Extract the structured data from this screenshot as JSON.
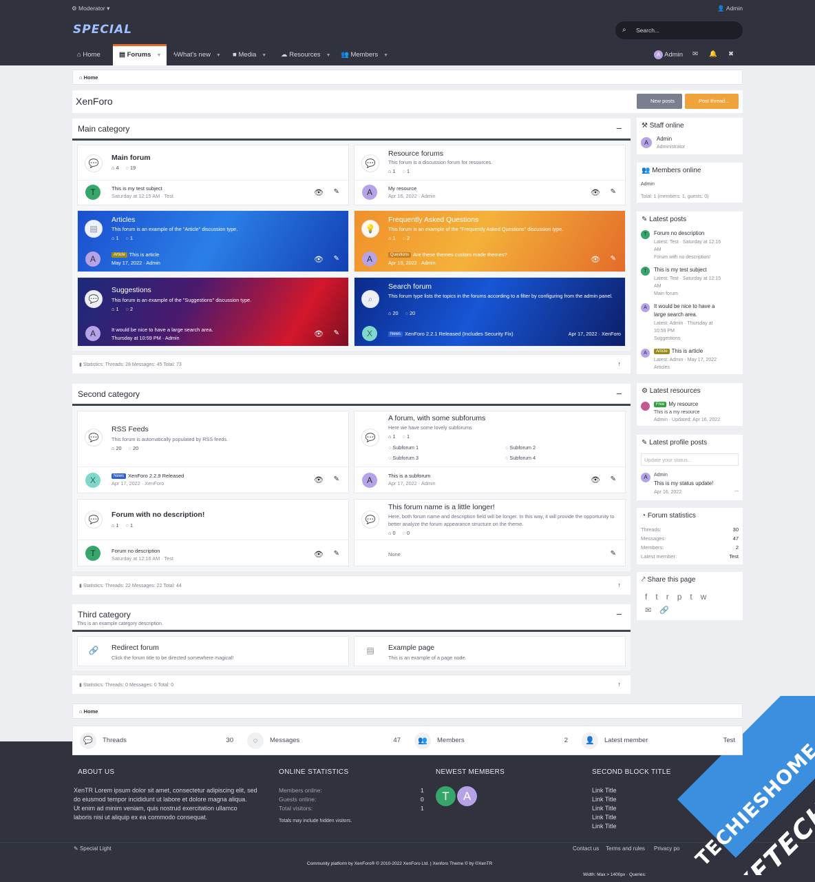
{
  "topbar": {
    "left": "Moderator ▾",
    "right": "Admin"
  },
  "header": {
    "logo": "SPECIAL",
    "search_placeholder": "Search..."
  },
  "nav": {
    "items": [
      {
        "label": "Home"
      },
      {
        "label": "Forums"
      },
      {
        "label": "What's new"
      },
      {
        "label": "Media"
      },
      {
        "label": "Resources"
      },
      {
        "label": "Members"
      }
    ],
    "user": "Admin"
  },
  "breadcrumb": {
    "label": "Home"
  },
  "page": {
    "title": "XenForo",
    "new_posts": "New posts",
    "post_thread": "Post thread..."
  },
  "categories": [
    {
      "title": "Main category",
      "description": "",
      "stats": "Statistics: Threads: 28 Messages: 45 Total: 73"
    },
    {
      "title": "Second category",
      "description": "",
      "stats": "Statistics: Threads: 22 Messages: 22 Total: 44"
    },
    {
      "title": "Third category",
      "description": "This is an example category description.",
      "stats": "Statistics: Threads: 0 Messages: 0 Total: 0"
    }
  ],
  "forums": {
    "main_forum": {
      "title": "Main forum",
      "threads": "4",
      "messages": "19",
      "last_title": "This is my test subject",
      "last_meta": "Saturday at 12:15 AM · Test",
      "avatar": "T"
    },
    "resource_forums": {
      "title": "Resource forums",
      "desc": "This forum is a discussion forum for resources.",
      "threads": "1",
      "messages": "1",
      "last_title": "My resource",
      "last_meta": "Apr 16, 2022 · Admin",
      "avatar": "A"
    },
    "articles": {
      "title": "Articles",
      "desc": "This forum is an example of the \"Article\" discussion type.",
      "threads": "1",
      "messages": "1",
      "badge": "Article",
      "last_title": "This is article",
      "last_meta": "May 17, 2022 · Admin",
      "avatar": "A"
    },
    "faq": {
      "title": "Frequently Asked Questions",
      "desc": "This forum is an example of the \"Frequently Asked Questions\" discussion type.",
      "threads": "1",
      "messages": "2",
      "badge": "Questions",
      "last_title": "Are these themes custom made themes?",
      "last_meta": "Apr 19, 2022 · Admin",
      "avatar": "A"
    },
    "suggestions": {
      "title": "Suggestions",
      "desc": "This forum is an example of the \"Suggestions\" discussion type.",
      "threads": "1",
      "messages": "2",
      "last_title": "It would be nice to have a large search area.",
      "last_meta": "Thursday at 10:59 PM · Admin",
      "avatar": "A"
    },
    "search_forum": {
      "title": "Search forum",
      "desc": "This forum type lists the topics in the forums according to a filter by configuring from the admin panel.",
      "threads": "20",
      "messages": "20",
      "badge": "News",
      "last_title": "XenForo 2.2.1 Released (Includes Security Fix)",
      "last_meta": "Apr 17, 2022 · XenForo",
      "avatar": "X"
    },
    "rss": {
      "title": "RSS Feeds",
      "desc": "This forum is automatically populated by RSS feeds.",
      "threads": "20",
      "messages": "20",
      "badge": "News",
      "last_title": "XenForo 2.2.9 Released",
      "last_meta": "Apr 17, 2022 · XenForo",
      "avatar": "X"
    },
    "subforums": {
      "title": "A forum, with some subforums",
      "desc": "Here we have some lovely subforums",
      "threads": "1",
      "messages": "1",
      "sub": [
        "Subforum 1",
        "Subforum 2",
        "Subforum 3",
        "Subforum 4"
      ],
      "last_title": "This is a subforum",
      "last_meta": "Apr 17, 2022 · Admin",
      "avatar": "A"
    },
    "nodesc": {
      "title": "Forum with no description!",
      "threads": "1",
      "messages": "1",
      "last_title": "Forum no description",
      "last_meta": "Saturday at 12:16 AM · Test",
      "avatar": "T"
    },
    "longer": {
      "title": "This forum name is a little longer!",
      "desc": "Here, both forum name and description field will be longer. In this way, it will provide the opportunity to better analyze the forum appearance structure on the theme.",
      "threads": "0",
      "messages": "0",
      "last_title": "None"
    },
    "redirect": {
      "title": "Redirect forum",
      "desc": "Click the forum title to be directed somewhere magical!"
    },
    "example_page": {
      "title": "Example page",
      "desc": "This is an example of a page node."
    }
  },
  "sidebar": {
    "staff": {
      "title": "Staff online",
      "name": "Admin",
      "role": "Administrator",
      "avatar": "A"
    },
    "members": {
      "title": "Members online",
      "name": "Admin",
      "total": "Total: 1 (members: 1, guests: 0)"
    },
    "latest_posts": {
      "title": "Latest posts",
      "items": [
        {
          "avatar": "T",
          "title": "Forum no description",
          "meta1": "Latest: Test · Saturday at 12:16",
          "meta2": "AM",
          "forum": "Forum with no description!"
        },
        {
          "avatar": "T",
          "title": "This is my test subject",
          "meta1": "Latest: Test · Saturday at 12:15",
          "meta2": "AM",
          "forum": "Main forum"
        },
        {
          "avatar": "A",
          "title1": "It would be nice to have a",
          "title2": "large search area.",
          "meta1": "Latest: Admin · Thursday at",
          "meta2": "10:59 PM",
          "forum": "Suggestions"
        },
        {
          "avatar": "A",
          "badge": "Article",
          "title": "This is article",
          "meta1": "Latest: Admin · May 17, 2022",
          "forum": "Articles"
        }
      ]
    },
    "latest_resources": {
      "title": "Latest resources",
      "badge": "Free",
      "name": "My resource",
      "desc": "This is a my resource",
      "meta": "Admin · Updated: Apr 16, 2022"
    },
    "profile_posts": {
      "title": "Latest profile posts",
      "placeholder": "Update your status...",
      "name": "Admin",
      "text": "This is my status update!",
      "date": "Apr 16, 2022",
      "more": "..."
    },
    "forum_stats": {
      "title": "Forum statistics",
      "rows": [
        {
          "k": "Threads:",
          "v": "30"
        },
        {
          "k": "Messages:",
          "v": "47"
        },
        {
          "k": "Members:",
          "v": "2"
        },
        {
          "k": "Latest member:",
          "v": "Test"
        }
      ]
    },
    "share": {
      "title": "Share this page"
    }
  },
  "footer_breadcrumb": "Home",
  "footer_stats": [
    {
      "k": "Threads",
      "v": "30"
    },
    {
      "k": "Messages",
      "v": "47"
    },
    {
      "k": "Members",
      "v": "2"
    },
    {
      "k": "Latest member",
      "v": "Test"
    }
  ],
  "footer": {
    "about_title": "ABOUT US",
    "about_lines": [
      "XenTR Lorem ipsum dolor sit amet, consectetur adipiscing elit, sed",
      "do eiusmod tempor incididunt ut labore et dolore magna aliqua.",
      "Ut enim ad minim veniam, quis nostrud exercitation ullamco",
      "laboris nisi ut aliquip ex ea commodo consequat."
    ],
    "online_title": "ONLINE STATISTICS",
    "online_rows": [
      {
        "k": "Members online:",
        "v": "1"
      },
      {
        "k": "Guests online:",
        "v": "0"
      },
      {
        "k": "Total visitors:",
        "v": "1"
      }
    ],
    "online_note": "Totals may include hidden visitors.",
    "newest_title": "NEWEST MEMBERS",
    "newest": [
      "T",
      "A"
    ],
    "second_title": "SECOND BLOCK TITLE",
    "links": [
      "Link Title",
      "Link Title",
      "Link Title",
      "Link Title",
      "Link Title"
    ]
  },
  "bottom": {
    "style": "Special Light",
    "contact": "Contact us",
    "terms": "Terms and rules",
    "privacy": "Privacy po",
    "copyright": "Community platform by XenForo® © 2010-2022 XenForo Ltd. | Xenforo Theme © by ©XenTR",
    "debug": "Width: Max > 1400px · Queries:"
  },
  "watermark": {
    "line1": "TECHIESHOME.COM",
    "line2": "XFTECH"
  },
  "colors": {
    "accent": "#e36c2a",
    "dark": "#30333d",
    "new_posts": "#7a7f8f",
    "post_thread": "#f0a23b"
  }
}
